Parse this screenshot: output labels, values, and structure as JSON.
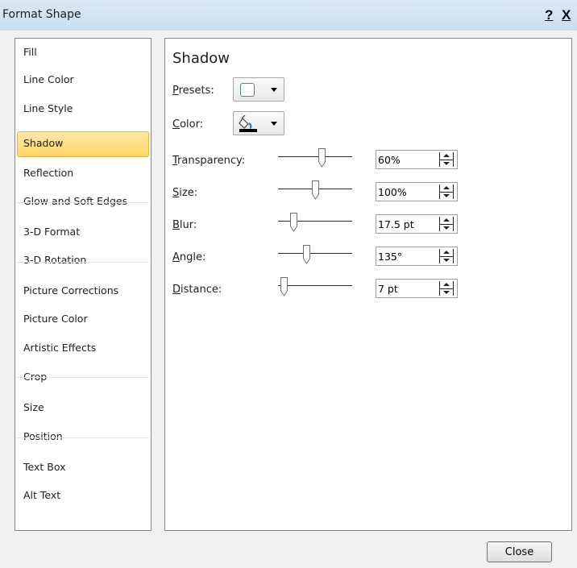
{
  "window": {
    "title": "Format Shape",
    "help_label": "?",
    "close_label": "X"
  },
  "nav": {
    "items": [
      "Fill",
      "Line Color",
      "Line Style",
      "Shadow",
      "Reflection",
      "Glow and Soft Edges",
      "3-D Format",
      "3-D Rotation",
      "Picture Corrections",
      "Picture Color",
      "Artistic Effects",
      "Crop",
      "Size",
      "Position",
      "Text Box",
      "Alt Text"
    ],
    "selected": "Shadow"
  },
  "panel": {
    "title": "Shadow",
    "presets": {
      "key": "P",
      "rest": "resets:"
    },
    "color": {
      "key": "C",
      "rest": "olor:"
    },
    "rows": [
      {
        "key": "T",
        "rest": "ransparency:",
        "value": "60%",
        "level": 0.6
      },
      {
        "key": "S",
        "rest": "ize:",
        "value": "100%",
        "level": 0.5
      },
      {
        "key": "B",
        "rest": "lur:",
        "value": "17.5 pt",
        "level": 0.175
      },
      {
        "key": "A",
        "rest": "ngle:",
        "value": "135°",
        "level": 0.375
      },
      {
        "key": "D",
        "rest": "istance:",
        "value": "7 pt",
        "level": 0.035
      }
    ]
  },
  "footer": {
    "close_label": "Close"
  },
  "colors": {
    "selected_fill": "#ffd567",
    "selected_border": "#e5b434",
    "accent": "#4f81bd"
  },
  "icons": {
    "presets": "shadow-preset-swatch-icon",
    "color": "paint-bucket-icon",
    "dropdown": "dropdown-arrow-icon"
  }
}
